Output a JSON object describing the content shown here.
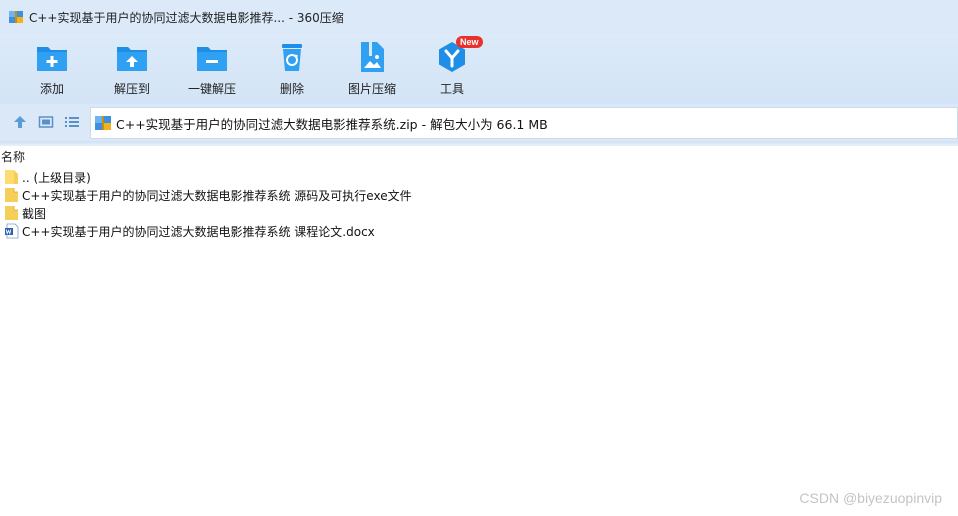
{
  "window": {
    "title": "C++实现基于用户的协同过滤大数据电影推荐... - 360压缩"
  },
  "toolbar": {
    "add_label": "添加",
    "extract_to_label": "解压到",
    "one_click_extract_label": "一键解压",
    "delete_label": "删除",
    "image_compress_label": "图片压缩",
    "tools_label": "工具",
    "tools_badge": "New"
  },
  "pathbar": {
    "path": "C++实现基于用户的协同过滤大数据电影推荐系统.zip - 解包大小为 66.1 MB"
  },
  "list": {
    "column_name": "名称",
    "items": [
      {
        "name": ".. (上级目录)",
        "type": "folder"
      },
      {
        "name": "C++实现基于用户的协同过滤大数据电影推荐系统 源码及可执行exe文件",
        "type": "folder-doc"
      },
      {
        "name": "截图",
        "type": "folder-doc"
      },
      {
        "name": "C++实现基于用户的协同过滤大数据电影推荐系统 课程论文.docx",
        "type": "docx"
      }
    ]
  },
  "watermark": "CSDN @biyezuopinvip",
  "colors": {
    "accent": "#1e8ee6",
    "badge": "#e8322b",
    "toolbar_bg": "#d3e4f6"
  }
}
